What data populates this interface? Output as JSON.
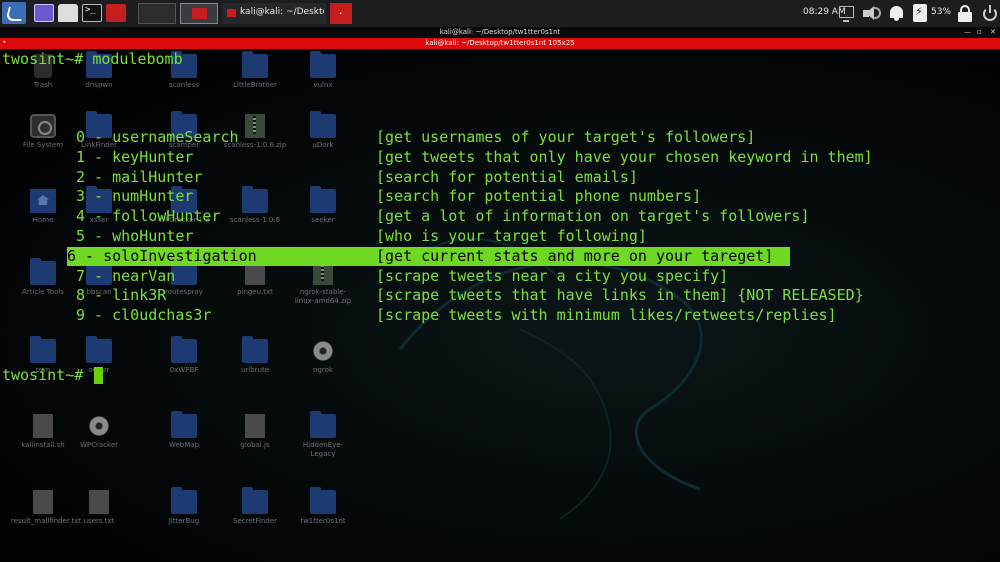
{
  "taskbar": {
    "terminal_task_label": "kali@kali: ~/Desktop/tw",
    "clock": "08:29 AM",
    "battery_percent": "53%"
  },
  "window": {
    "title": "kali@kali: ~/Desktop/tw1tter0s1nt",
    "tab_title": "kali@kali: ~/Desktop/tw1tter0s1nt 105x25",
    "controls": [
      "—",
      "▫",
      "✕"
    ]
  },
  "terminal": {
    "prompt": "twosint~#",
    "command": "modulebomb",
    "modules": [
      {
        "name": "0 - usernameSearch",
        "desc": "[get usernames of your target's followers]"
      },
      {
        "name": "1 - keyHunter",
        "desc": "[get tweets that only have your chosen keyword in them]"
      },
      {
        "name": "2 - mailHunter",
        "desc": "[search for potential emails]"
      },
      {
        "name": "3 - numHunter",
        "desc": "[search for potential phone numbers]"
      },
      {
        "name": "4 - followHunter",
        "desc": "[get a lot of information on target's followers]"
      },
      {
        "name": "5 - whoHunter",
        "desc": "[who is your target following]"
      },
      {
        "name": "6 - soloInvestigation",
        "desc": "[get current stats and more on your tareget]"
      },
      {
        "name": "7 - nearVan",
        "desc": "[scrape tweets near a city you specify]"
      },
      {
        "name": "8 - link3R",
        "desc": "[scrape tweets that have links in them] {NOT RELEASED}"
      },
      {
        "name": "9 - cl0udchas3r",
        "desc": "[scrape tweets with minimum likes/retweets/replies]"
      }
    ],
    "selected_index": 6
  },
  "desktop": {
    "icons": [
      {
        "label": "Trash",
        "type": "trash"
      },
      {
        "label": "dnspwn",
        "type": "folder"
      },
      {
        "label": "scanless",
        "type": "folder"
      },
      {
        "label": "LittleBrother",
        "type": "folder"
      },
      {
        "label": "vulnx",
        "type": "folder"
      },
      {
        "label": "File System",
        "type": "disk"
      },
      {
        "label": "LinkFinder",
        "type": "folder"
      },
      {
        "label": "scamper",
        "type": "folder"
      },
      {
        "label": "scanless-1.0.6.zip",
        "type": "zip"
      },
      {
        "label": "uDork",
        "type": "folder"
      },
      {
        "label": "Home",
        "type": "home"
      },
      {
        "label": "xsser",
        "type": "folder"
      },
      {
        "label": "WPCracker-1.3",
        "type": "folder"
      },
      {
        "label": "scanless-1.0.6",
        "type": "folder"
      },
      {
        "label": "seeker",
        "type": "folder"
      },
      {
        "label": "Article Tools",
        "type": "folder"
      },
      {
        "label": "bbscan",
        "type": "folder"
      },
      {
        "label": "routespray",
        "type": "folder"
      },
      {
        "label": "pingeu.txt",
        "type": "file"
      },
      {
        "label": "ngrok-stable-linux-amd64.zip",
        "type": "zip"
      },
      {
        "label": "pwn",
        "type": "folder"
      },
      {
        "label": "oumrr",
        "type": "folder"
      },
      {
        "label": "0xWPBF",
        "type": "folder"
      },
      {
        "label": "urlbrute",
        "type": "folder"
      },
      {
        "label": "ngrok",
        "type": "gear"
      },
      {
        "label": "kaliinstall.sh",
        "type": "file"
      },
      {
        "label": "WPCracker",
        "type": "gear"
      },
      {
        "label": "WebMap",
        "type": "folder"
      },
      {
        "label": "global.js",
        "type": "file"
      },
      {
        "label": "HiddenEye-Legacy",
        "type": "folder"
      },
      {
        "label": "result_mailfinder.txt",
        "type": "file"
      },
      {
        "label": "users.txt",
        "type": "file"
      },
      {
        "label": "JitterBug",
        "type": "folder"
      },
      {
        "label": "SecretFinder",
        "type": "folder"
      },
      {
        "label": "tw1tter0s1nt",
        "type": "folder"
      }
    ]
  }
}
